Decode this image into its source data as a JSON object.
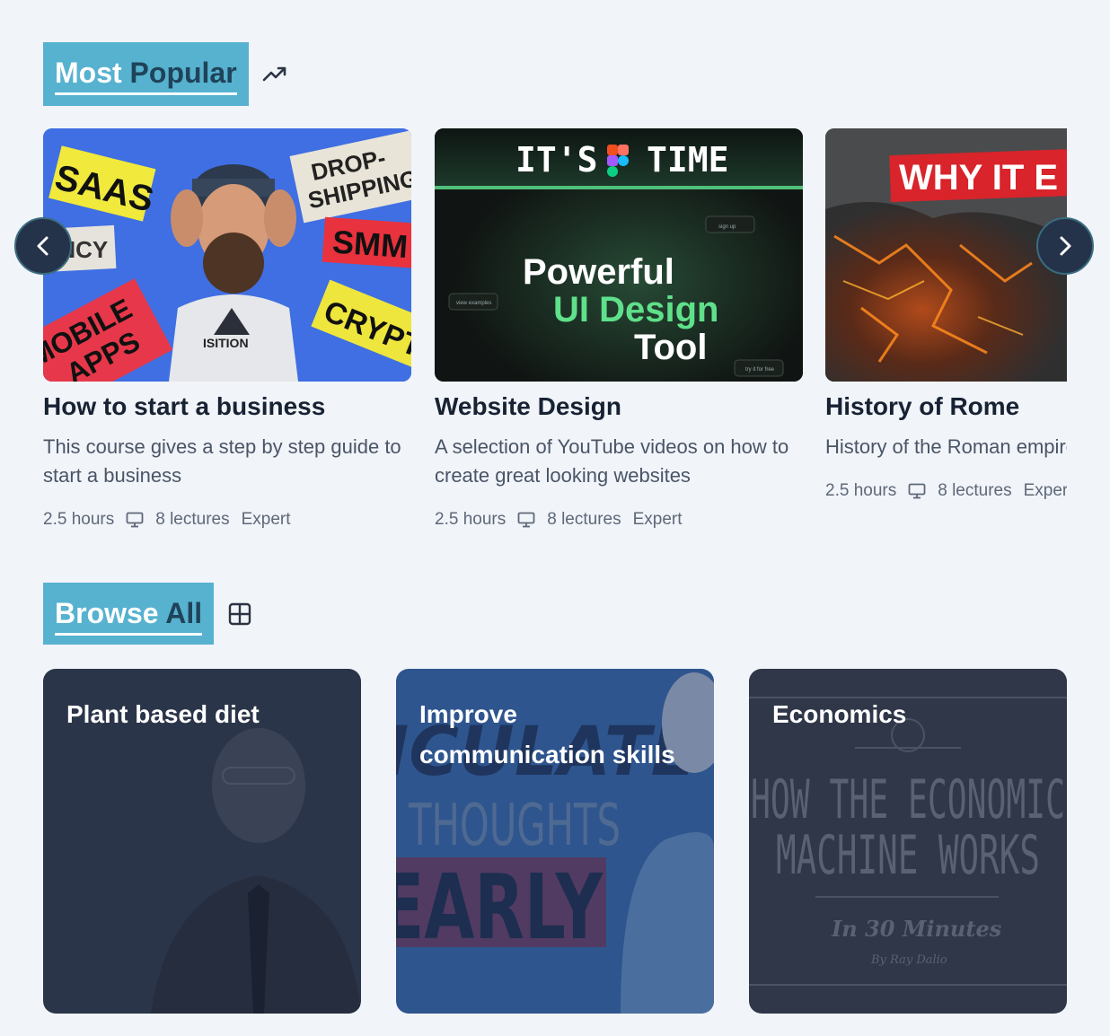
{
  "most_popular": {
    "title_word1": "Most",
    "title_word2": "Popular",
    "icon": "trending-up-icon"
  },
  "carousel": {
    "prev_icon": "chevron-left-icon",
    "next_icon": "chevron-right-icon",
    "cards": [
      {
        "title": "How to start a business",
        "description": "This course gives a step by step guide to start a business",
        "duration": "2.5 hours",
        "lectures": "8 lectures",
        "level": "Expert",
        "thumb_labels": [
          "SAAS",
          "DROP-",
          "SHIPPING",
          "SMM",
          "ENCY",
          "CRYPTO",
          "MOBILE",
          "APPS",
          "ISITION"
        ]
      },
      {
        "title": "Website Design",
        "description": "A selection of YouTube videos on how to create great looking websites",
        "duration": "2.5 hours",
        "lectures": "8 lectures",
        "level": "Expert",
        "thumb_labels": [
          "IT'S",
          "TIME",
          "Powerful",
          "UI Design",
          "Tool",
          "sign up",
          "view examples",
          "try it for free"
        ]
      },
      {
        "title": "History of Rome",
        "description": "History of the Roman empire",
        "duration": "2.5 hours",
        "lectures": "8 lectures",
        "level": "Expert",
        "thumb_labels": [
          "WHY IT E"
        ]
      }
    ]
  },
  "browse_all": {
    "title_word1": "Browse",
    "title_word2": "All",
    "icon": "grid-icon",
    "tiles": [
      {
        "title": "Plant based diet",
        "bg_labels": []
      },
      {
        "title": "Improve communication skills",
        "bg_labels": [
          "ICULATE",
          "THOUGHTS",
          "EARLY"
        ]
      },
      {
        "title": "Economics",
        "bg_labels": [
          "HOW THE ECONOMIC",
          "MACHINE WORKS",
          "In 30 Minutes",
          "By Ray Dalio"
        ]
      }
    ]
  },
  "colors": {
    "page_bg": "#f1f4f9",
    "accent": "#56b2cf",
    "accent_dark": "#1f4359",
    "tile_overlay": "#2b3549",
    "nav_button": "#25334a"
  }
}
